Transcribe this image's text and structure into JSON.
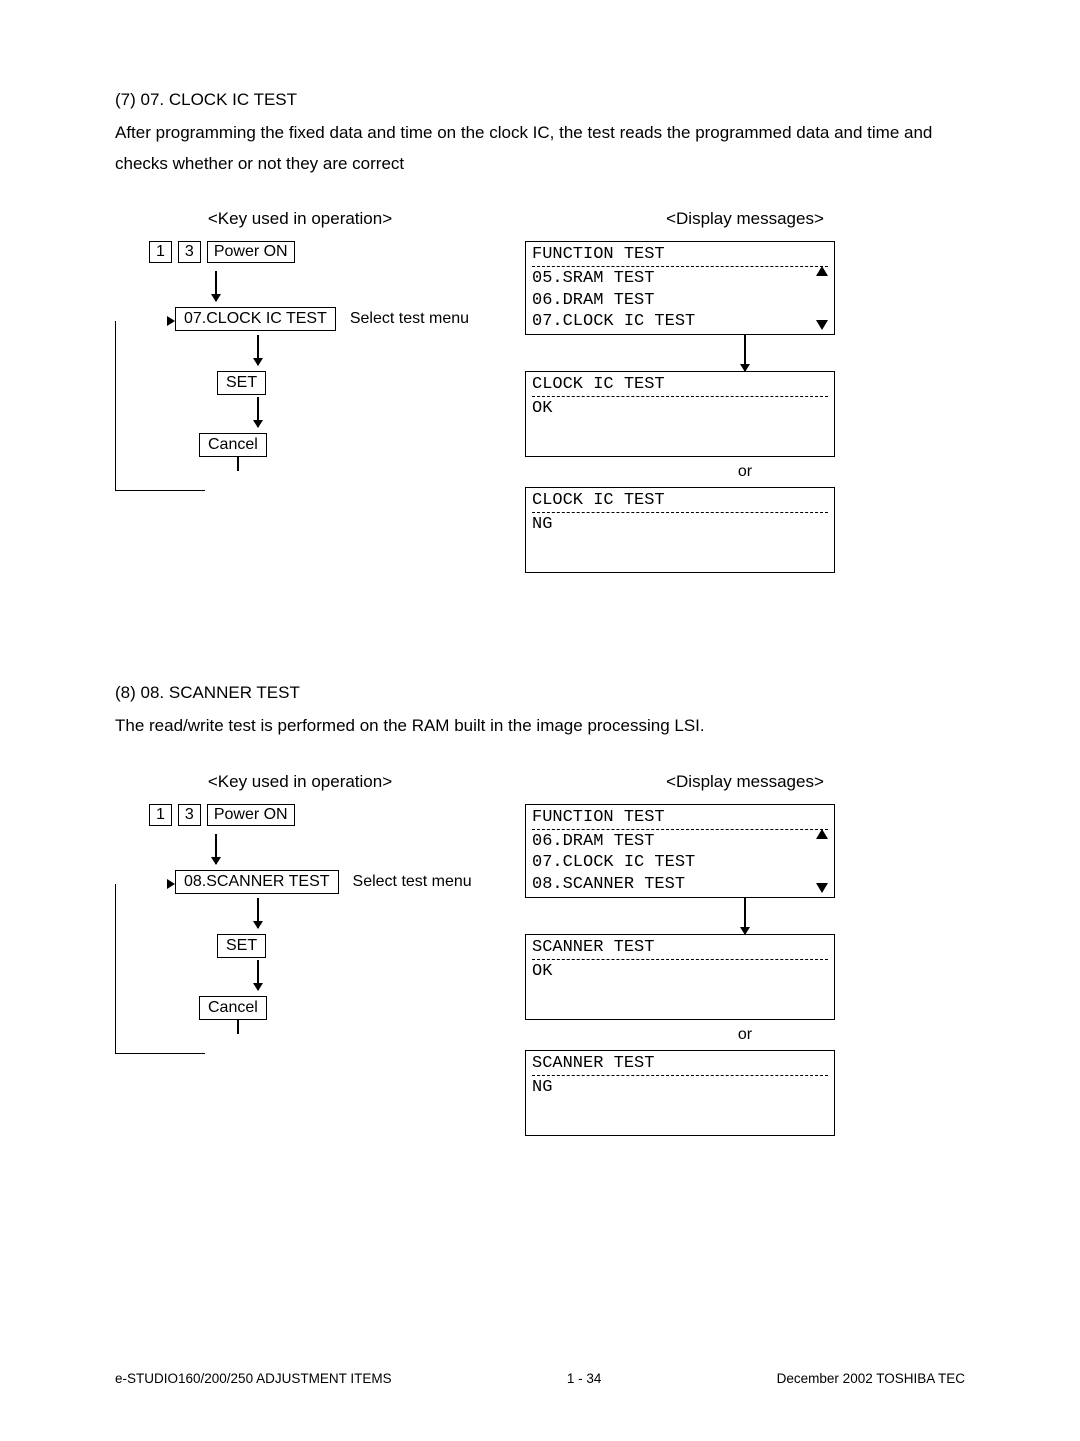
{
  "section7": {
    "heading": "(7) 07. CLOCK IC TEST",
    "body": "After programming the fixed data and time on the clock IC, the test reads the programmed data and time and checks whether or not they are correct",
    "left_header": "<Key used in operation>",
    "right_header": "<Display messages>",
    "keys": {
      "k1": "1",
      "k3": "3",
      "power": "Power ON"
    },
    "step_menu": "07.CLOCK IC TEST",
    "annot_menu": "Select test menu",
    "step_set": "SET",
    "step_cancel": "Cancel",
    "menu_display": {
      "title": "FUNCTION TEST",
      "l1": "05.SRAM TEST",
      "l2": "06.DRAM TEST",
      "l3": "07.CLOCK IC TEST"
    },
    "result_ok": {
      "title": "CLOCK IC TEST",
      "status": "OK"
    },
    "or": "or",
    "result_ng": {
      "title": "CLOCK IC TEST",
      "status": "NG"
    }
  },
  "section8": {
    "heading": "(8) 08. SCANNER TEST",
    "body": "The read/write test is performed on the RAM built in the image processing LSI.",
    "left_header": "<Key used in operation>",
    "right_header": "<Display messages>",
    "keys": {
      "k1": "1",
      "k3": "3",
      "power": "Power ON"
    },
    "step_menu": "08.SCANNER TEST",
    "annot_menu": "Select test menu",
    "step_set": "SET",
    "step_cancel": "Cancel",
    "menu_display": {
      "title": "FUNCTION TEST",
      "l1": "06.DRAM TEST",
      "l2": "07.CLOCK IC TEST",
      "l3": "08.SCANNER TEST"
    },
    "result_ok": {
      "title": "SCANNER TEST",
      "status": "OK"
    },
    "or": "or",
    "result_ng": {
      "title": "SCANNER TEST",
      "status": "NG"
    }
  },
  "footer": {
    "left": "e-STUDIO160/200/250 ADJUSTMENT ITEMS",
    "center": "1 - 34",
    "right": "December 2002 TOSHIBA TEC"
  }
}
